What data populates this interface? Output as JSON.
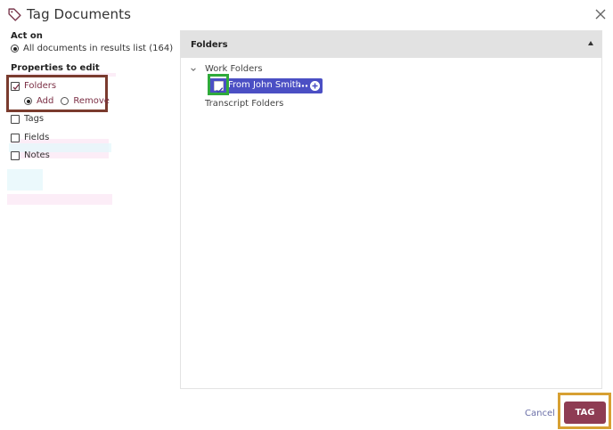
{
  "dialog": {
    "title": "Tag Documents",
    "title_icon": "tag-icon",
    "close_icon": "close-icon"
  },
  "left": {
    "act_on_label": "Act on",
    "act_on_option": "All documents in results list (164)",
    "properties_label": "Properties to edit",
    "properties": [
      {
        "label": "Folders",
        "checked": true
      },
      {
        "label": "Tags",
        "checked": false
      },
      {
        "label": "Fields",
        "checked": false
      },
      {
        "label": "Notes",
        "checked": false
      }
    ],
    "folder_mode": {
      "add_label": "Add",
      "remove_label": "Remove",
      "selected": "Add"
    }
  },
  "panel": {
    "title": "Folders",
    "tree": {
      "group_label": "Work Folders",
      "selected_folder": "From John Smith",
      "other_folder": "Transcript Folders"
    }
  },
  "footer": {
    "cancel_label": "Cancel",
    "tag_label": "TAG"
  },
  "colors": {
    "accent": "#8e3c53",
    "pill": "#4b4fc4",
    "link": "#6b6fa8"
  }
}
